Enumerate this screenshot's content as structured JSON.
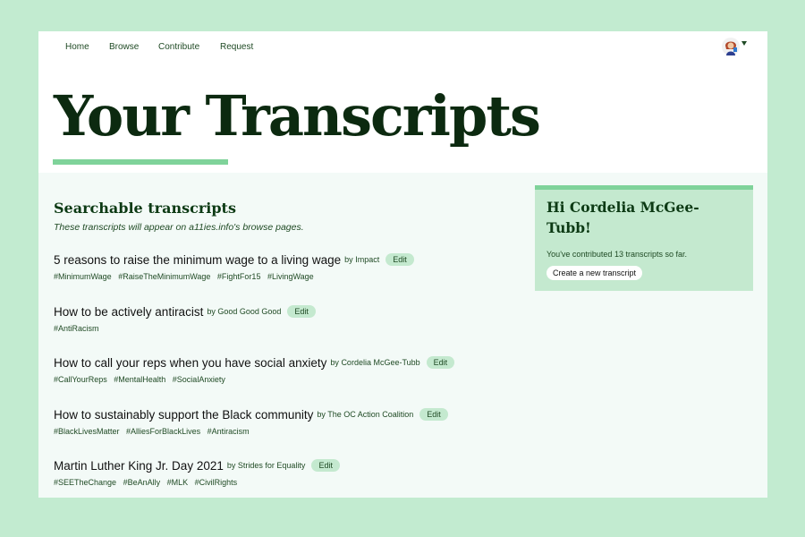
{
  "nav": {
    "home": "Home",
    "browse": "Browse",
    "contribute": "Contribute",
    "request": "Request"
  },
  "header": {
    "title": "Your Transcripts"
  },
  "main": {
    "section_title": "Searchable transcripts",
    "section_subtitle": "These transcripts will appear on a11ies.info's browse pages.",
    "edit_label": "Edit",
    "items": [
      {
        "title": "5 reasons to raise the minimum wage to a living wage",
        "by": "by",
        "author": "Impact",
        "tags": [
          "#MinimumWage",
          "#RaiseTheMinimumWage",
          "#FightFor15",
          "#LivingWage"
        ]
      },
      {
        "title": "How to be actively antiracist",
        "by": "by",
        "author": "Good Good Good",
        "tags": [
          "#AntiRacism"
        ]
      },
      {
        "title": "How to call your reps when you have social anxiety",
        "by": "by",
        "author": "Cordelia McGee-Tubb",
        "tags": [
          "#CallYourReps",
          "#MentalHealth",
          "#SocialAnxiety"
        ]
      },
      {
        "title": "How to sustainably support the Black community",
        "by": "by",
        "author": "The OC Action Coalition",
        "tags": [
          "#BlackLivesMatter",
          "#AlliesForBlackLives",
          "#Antiracism"
        ]
      },
      {
        "title": "Martin Luther King Jr. Day 2021",
        "by": "by",
        "author": "Strides for Equality",
        "tags": [
          "#SEETheChange",
          "#BeAnAlly",
          "#MLK",
          "#CivilRights"
        ]
      }
    ]
  },
  "sidebar": {
    "greeting": "Hi Cordelia McGee-Tubb!",
    "contrib_text": "You've contributed 13 transcripts so far.",
    "create_button": "Create a new transcript"
  },
  "icons": {
    "avatar": "user-avatar-icon",
    "caret": "caret-down-icon"
  },
  "colors": {
    "page_bg": "#c2ebd0",
    "accent": "#7fd39a",
    "title_dark": "#0c2a10",
    "link_green": "#1f4a24",
    "pill_bg": "#c4e9cf"
  }
}
